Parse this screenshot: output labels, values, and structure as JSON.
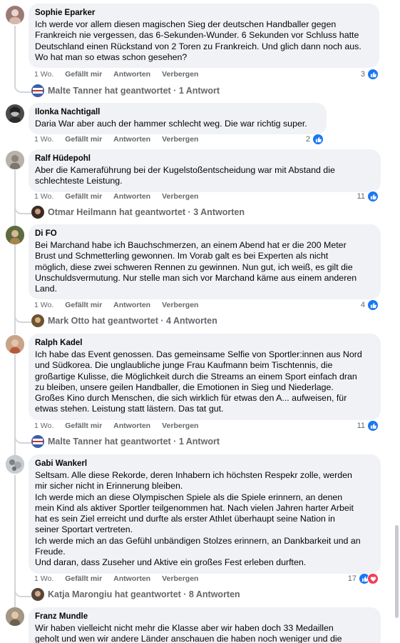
{
  "comments": [
    {
      "author": "Sophie Eparker",
      "text": "Ich werde vor allem diesen magischen Sieg der deutschen Handballer gegen\nFrankreich nie vergessen, das 6-Sekunden-Wunder. 6 Sekunden vor Schluss hatte\nDeutschland einen Rückstand von 2 Toren zu Frankreich. Und glich dann noch aus.\nWo hat man so etwas schon gesehen?",
      "time": "1 Wo.",
      "like": "Gefällt mir",
      "reply": "Antworten",
      "hide": "Verbergen",
      "reaction_count": "3",
      "replies": "Malte Tanner hat geantwortet · 1 Antwort",
      "avatar_color": "#9c7a74"
    },
    {
      "author": "Ilonka Nachtigall",
      "text": "Daria War aber auch der hammer schlecht weg. Die war richtig super.",
      "time": "1 Wo.",
      "like": "Gefällt mir",
      "reply": "Antworten",
      "hide": "Verbergen",
      "reaction_count": "2",
      "avatar_color": "#4a4a4a"
    },
    {
      "author": "Ralf Hüdepohl",
      "text": "Aber die Kameraführung bei der Kugelstoßentscheidung war mit Abstand die\nschlechteste Leistung.",
      "time": "1 Wo.",
      "like": "Gefällt mir",
      "reply": "Antworten",
      "hide": "Verbergen",
      "reaction_count": "11",
      "replies": "Otmar Heilmann hat geantwortet · 3 Antworten",
      "avatar_color": "#a7a39c"
    },
    {
      "author": "Di FO",
      "text": "Bei Marchand habe ich Bauchschmerzen, an einem Abend hat er die 200 Meter\nBrust und Schmetterling gewonnen. Im Vorab galt es bei Experten als nicht\nmöglich, diese zwei schweren Rennen zu gewinnen. Nun gut, ich weiß, es gilt die\nUnschuldsvermutung. Nur stelle man sich vor Marchand käme aus einem anderen\nLand.",
      "time": "1 Wo.",
      "like": "Gefällt mir",
      "reply": "Antworten",
      "hide": "Verbergen",
      "reaction_count": "4",
      "replies": "Mark Otto hat geantwortet · 4 Antworten",
      "avatar_color": "#6b7a4f"
    },
    {
      "author": "Ralph Kadel",
      "text": "Ich habe das Event genossen. Das gemeinsame Selfie von Sportler:innen aus Nord\nund Südkorea. Die unglaubliche junge Frau Kaufmann beim Tischtennis, die\ngroßartige Kulisse, die Möglichkeit durch die Streams an einem Sport einfach dran\nzu bleiben, unsere geilen Handballer, die Emotionen in Sieg und Niederlage.\nGroßes Kino durch Menschen, die sich wirklich für etwas den A... aufweisen, für\netwas stehen. Leistung statt lästern. Das tat gut.",
      "time": "1 Wo.",
      "like": "Gefällt mir",
      "reply": "Antworten",
      "hide": "Verbergen",
      "reaction_count": "11",
      "replies": "Malte Tanner hat geantwortet · 1 Antwort",
      "avatar_color": "#b56a4a"
    },
    {
      "author": "Gabi Wankerl",
      "text": "Seltsam. Alle diese Rekorde, deren Inhabern ich höchsten Respekr zolle, werden\nmir sicher nicht in Erinnerung bleiben.\nIch werde mich an diese Olympischen Spiele als die Spiele erinnern, an denen\nmein Kind als aktiver Sportler teilgenommen hat. Nach vielen Jahren harter Arbeit\nhat es sein Ziel erreicht und durfte als erster Athlet überhaupt seine Nation in\nseiner Sportart vertreten.\nIch werde mich an das Gefühl unbändigen Stolzes erinnern, an Dankbarkeit und an\nFreude.\nUnd daran, dass Zuseher und Aktive ein großes Fest erleben durften.",
      "time": "1 Wo.",
      "like": "Gefällt mir",
      "reply": "Antworten",
      "hide": "Verbergen",
      "reaction_count": "17",
      "replies": "Katja Marongiu hat geantwortet · 8 Antworten",
      "avatar_color": "#9aa0a6"
    },
    {
      "author": "Franz Mundle",
      "text": "Wir haben vielleicht nicht mehr die Klasse aber wir haben doch 33 Medaillen\ngeholt und wen wir andere Länder anschauen die haben noch weniger und die",
      "avatar_color": "#8d7f6c"
    }
  ],
  "colors": {
    "like": "#1877f2",
    "heart": "#f33e58",
    "bubble": "#f0f2f5",
    "meta": "#65676b"
  },
  "icons": {
    "like": "thumbs-up-icon",
    "heart": "heart-icon"
  }
}
